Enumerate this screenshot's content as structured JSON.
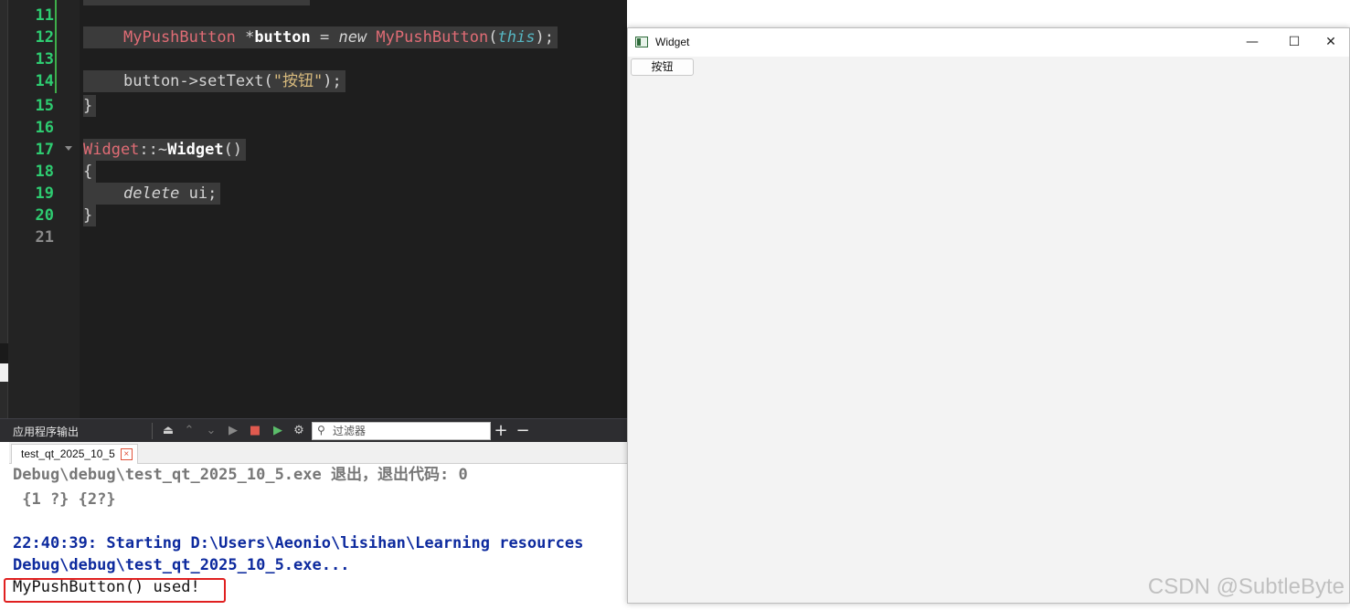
{
  "editor": {
    "line_numbers": [
      "11",
      "12",
      "13",
      "14",
      "15",
      "16",
      "17",
      "18",
      "19",
      "20",
      "21"
    ],
    "lines": {
      "l12": {
        "cls": "MyPushButton",
        "star": " *",
        "var": "button",
        "eq": " = ",
        "new": "new",
        "cls2": "MyPushButton",
        "paren_open": "(",
        "this": "this",
        "paren_close": ");"
      },
      "l14": {
        "prefix": "button->setText(",
        "string": "\"按钮\"",
        "suffix": ");"
      },
      "l15": "}",
      "l17": {
        "cls": "Widget",
        "sep": "::~",
        "name": "Widget",
        "parens": "()"
      },
      "l18": "{",
      "l19": {
        "del": "delete",
        "rest": " ui;"
      },
      "l20": "}"
    }
  },
  "output_pane": {
    "title": "应用程序输出",
    "filter_placeholder": "过滤器",
    "tab_label": "test_qt_2025_10_5",
    "tab_close": "×",
    "add_icon": "+",
    "remove_icon": "−",
    "lines": [
      "Debug\\debug\\test_qt_2025_10_5.exe 退出，退出代码: 0",
      " {1 ?} {2?}",
      "",
      "22:40:39: Starting D:\\Users\\Aeonio\\lisihan\\Learning resources",
      "Debug\\debug\\test_qt_2025_10_5.exe...",
      "MyPushButton() used!"
    ]
  },
  "widget_window": {
    "title": "Widget",
    "minimize": "—",
    "maximize": "☐",
    "close": "✕",
    "button_label": "按钮"
  },
  "watermark": "CSDN @SubtleByte"
}
